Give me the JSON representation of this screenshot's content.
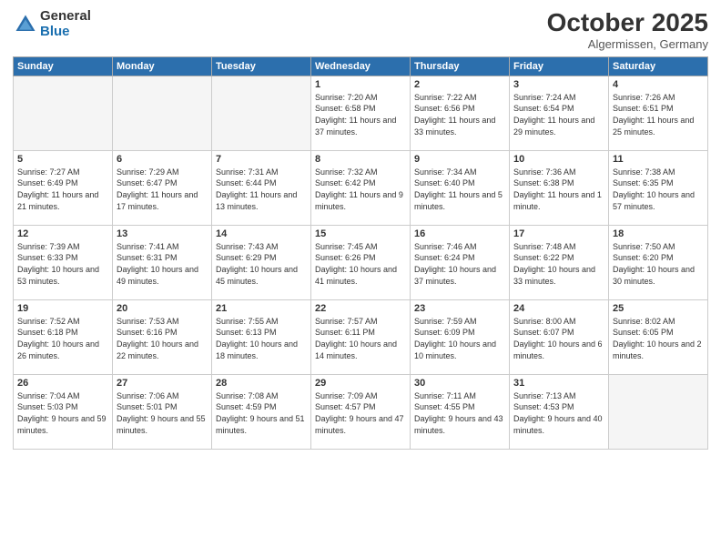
{
  "logo": {
    "general": "General",
    "blue": "Blue"
  },
  "header": {
    "month": "October 2025",
    "location": "Algermissen, Germany"
  },
  "weekdays": [
    "Sunday",
    "Monday",
    "Tuesday",
    "Wednesday",
    "Thursday",
    "Friday",
    "Saturday"
  ],
  "weeks": [
    [
      {
        "day": "",
        "empty": true
      },
      {
        "day": "",
        "empty": true
      },
      {
        "day": "",
        "empty": true
      },
      {
        "day": "1",
        "sunrise": "7:20 AM",
        "sunset": "6:58 PM",
        "daylight": "11 hours and 37 minutes."
      },
      {
        "day": "2",
        "sunrise": "7:22 AM",
        "sunset": "6:56 PM",
        "daylight": "11 hours and 33 minutes."
      },
      {
        "day": "3",
        "sunrise": "7:24 AM",
        "sunset": "6:54 PM",
        "daylight": "11 hours and 29 minutes."
      },
      {
        "day": "4",
        "sunrise": "7:26 AM",
        "sunset": "6:51 PM",
        "daylight": "11 hours and 25 minutes."
      }
    ],
    [
      {
        "day": "5",
        "sunrise": "7:27 AM",
        "sunset": "6:49 PM",
        "daylight": "11 hours and 21 minutes."
      },
      {
        "day": "6",
        "sunrise": "7:29 AM",
        "sunset": "6:47 PM",
        "daylight": "11 hours and 17 minutes."
      },
      {
        "day": "7",
        "sunrise": "7:31 AM",
        "sunset": "6:44 PM",
        "daylight": "11 hours and 13 minutes."
      },
      {
        "day": "8",
        "sunrise": "7:32 AM",
        "sunset": "6:42 PM",
        "daylight": "11 hours and 9 minutes."
      },
      {
        "day": "9",
        "sunrise": "7:34 AM",
        "sunset": "6:40 PM",
        "daylight": "11 hours and 5 minutes."
      },
      {
        "day": "10",
        "sunrise": "7:36 AM",
        "sunset": "6:38 PM",
        "daylight": "11 hours and 1 minute."
      },
      {
        "day": "11",
        "sunrise": "7:38 AM",
        "sunset": "6:35 PM",
        "daylight": "10 hours and 57 minutes."
      }
    ],
    [
      {
        "day": "12",
        "sunrise": "7:39 AM",
        "sunset": "6:33 PM",
        "daylight": "10 hours and 53 minutes."
      },
      {
        "day": "13",
        "sunrise": "7:41 AM",
        "sunset": "6:31 PM",
        "daylight": "10 hours and 49 minutes."
      },
      {
        "day": "14",
        "sunrise": "7:43 AM",
        "sunset": "6:29 PM",
        "daylight": "10 hours and 45 minutes."
      },
      {
        "day": "15",
        "sunrise": "7:45 AM",
        "sunset": "6:26 PM",
        "daylight": "10 hours and 41 minutes."
      },
      {
        "day": "16",
        "sunrise": "7:46 AM",
        "sunset": "6:24 PM",
        "daylight": "10 hours and 37 minutes."
      },
      {
        "day": "17",
        "sunrise": "7:48 AM",
        "sunset": "6:22 PM",
        "daylight": "10 hours and 33 minutes."
      },
      {
        "day": "18",
        "sunrise": "7:50 AM",
        "sunset": "6:20 PM",
        "daylight": "10 hours and 30 minutes."
      }
    ],
    [
      {
        "day": "19",
        "sunrise": "7:52 AM",
        "sunset": "6:18 PM",
        "daylight": "10 hours and 26 minutes."
      },
      {
        "day": "20",
        "sunrise": "7:53 AM",
        "sunset": "6:16 PM",
        "daylight": "10 hours and 22 minutes."
      },
      {
        "day": "21",
        "sunrise": "7:55 AM",
        "sunset": "6:13 PM",
        "daylight": "10 hours and 18 minutes."
      },
      {
        "day": "22",
        "sunrise": "7:57 AM",
        "sunset": "6:11 PM",
        "daylight": "10 hours and 14 minutes."
      },
      {
        "day": "23",
        "sunrise": "7:59 AM",
        "sunset": "6:09 PM",
        "daylight": "10 hours and 10 minutes."
      },
      {
        "day": "24",
        "sunrise": "8:00 AM",
        "sunset": "6:07 PM",
        "daylight": "10 hours and 6 minutes."
      },
      {
        "day": "25",
        "sunrise": "8:02 AM",
        "sunset": "6:05 PM",
        "daylight": "10 hours and 2 minutes."
      }
    ],
    [
      {
        "day": "26",
        "sunrise": "7:04 AM",
        "sunset": "5:03 PM",
        "daylight": "9 hours and 59 minutes."
      },
      {
        "day": "27",
        "sunrise": "7:06 AM",
        "sunset": "5:01 PM",
        "daylight": "9 hours and 55 minutes."
      },
      {
        "day": "28",
        "sunrise": "7:08 AM",
        "sunset": "4:59 PM",
        "daylight": "9 hours and 51 minutes."
      },
      {
        "day": "29",
        "sunrise": "7:09 AM",
        "sunset": "4:57 PM",
        "daylight": "9 hours and 47 minutes."
      },
      {
        "day": "30",
        "sunrise": "7:11 AM",
        "sunset": "4:55 PM",
        "daylight": "9 hours and 43 minutes."
      },
      {
        "day": "31",
        "sunrise": "7:13 AM",
        "sunset": "4:53 PM",
        "daylight": "9 hours and 40 minutes."
      },
      {
        "day": "",
        "empty": true
      }
    ]
  ]
}
